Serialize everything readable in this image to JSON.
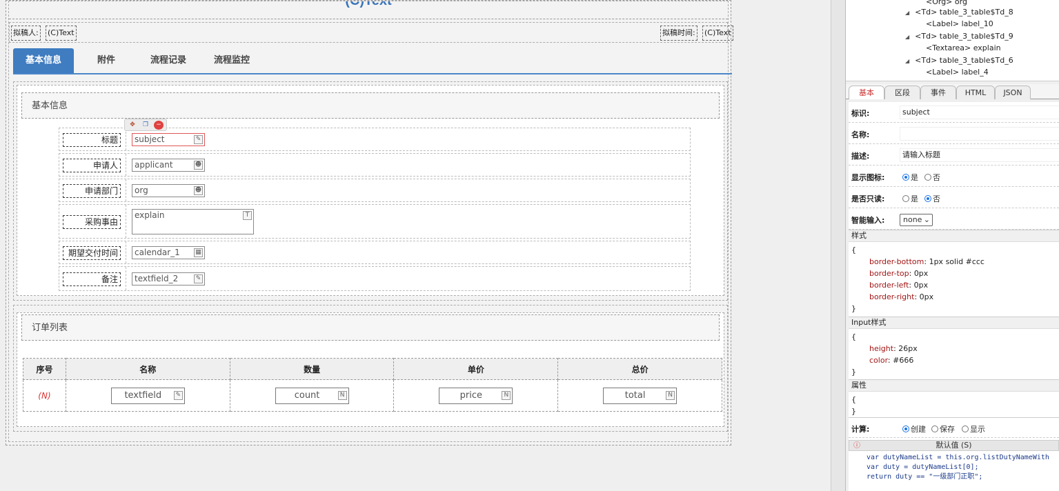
{
  "form": {
    "title": "(C)Text",
    "drafter_label": "拟稿人:",
    "drafter_value": "(C)Text",
    "draft_time_label": "拟稿时间:",
    "draft_time_value": "(C)Text",
    "tabs": [
      "基本信息",
      "附件",
      "流程记录",
      "流程监控"
    ],
    "basic_section": {
      "header": "基本信息",
      "fields": [
        {
          "label": "标题",
          "value": "subject",
          "icon": "edit-icon"
        },
        {
          "label": "申请人",
          "value": "applicant",
          "icon": "person-icon"
        },
        {
          "label": "申请部门",
          "value": "org",
          "icon": "person-icon"
        },
        {
          "label": "采购事由",
          "value": "explain",
          "icon": "textarea-icon"
        },
        {
          "label": "期望交付时间",
          "value": "calendar_1",
          "icon": "calendar-icon"
        },
        {
          "label": "备注",
          "value": "textfield_2",
          "icon": "edit-icon"
        }
      ]
    },
    "order_section": {
      "header": "订单列表",
      "columns": [
        "序号",
        "名称",
        "数量",
        "单价",
        "总价"
      ],
      "row": {
        "index": "(N)",
        "cells": [
          "textfield",
          "count",
          "price",
          "total"
        ]
      }
    }
  },
  "tree": {
    "items": [
      "<Org> org",
      "<Td> table_3_table$Td_8",
      "<Label> label_10",
      "<Td> table_3_table$Td_9",
      "<Textarea> explain",
      "<Td> table_3_table$Td_6",
      "<Label> label_4"
    ]
  },
  "props": {
    "tabs": [
      "基本",
      "区段",
      "事件",
      "HTML",
      "JSON"
    ],
    "id_label": "标识:",
    "id_value": "subject",
    "name_label": "名称:",
    "name_value": "",
    "desc_label": "描述:",
    "desc_value": "请输入标题",
    "show_icon_label": "显示图标:",
    "readonly_label": "是否只读:",
    "yes": "是",
    "no": "否",
    "smart_label": "智能输入:",
    "smart_value": "none",
    "style_header": "样式",
    "style_rules": [
      {
        "k": "border-bottom",
        "v": "1px solid #ccc"
      },
      {
        "k": "border-top",
        "v": "0px"
      },
      {
        "k": "border-left",
        "v": "0px"
      },
      {
        "k": "border-right",
        "v": "0px"
      }
    ],
    "input_style_header": "Input样式",
    "input_rules": [
      {
        "k": "height",
        "v": "26px"
      },
      {
        "k": "color",
        "v": "#666"
      }
    ],
    "attr_header": "属性",
    "open_brace": "{",
    "close_brace": "}",
    "calc_label": "计算:",
    "calc_options": [
      "创建",
      "保存",
      "显示"
    ],
    "default_header": "默认值 (S)",
    "warn_glyph": "ⓘ",
    "code_lines": [
      "var dutyNameList = this.org.listDutyNameWith",
      "var duty = dutyNameList[0];",
      "return duty == \"一级部门正职\";"
    ]
  }
}
